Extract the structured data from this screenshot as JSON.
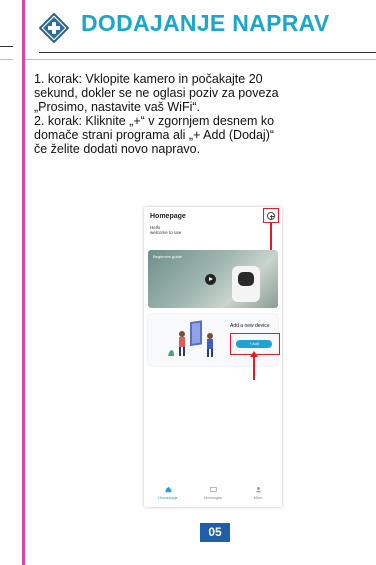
{
  "header": {
    "title": "DODAJANJE NAPRAV",
    "icon": "plus-diamond-icon",
    "accent_color": "#1aa7c9"
  },
  "instructions": {
    "lines": [
      "1. korak: Vklopite kamero in počakajte 20",
      "sekund, dokler se ne oglasi poziv za poveza",
      "„Prosimo, nastavite vaš WiFi“.",
      "2. korak: Kliknite „+“ v zgornjem desnem ko",
      "domače strani programa ali „+ Add (Dodaj)“",
      "če želite dodati novo napravo."
    ]
  },
  "phone": {
    "title": "Homepage",
    "hello": [
      "Hello",
      "welcome to use"
    ],
    "banner_label": "Beginners guide",
    "card_label": "Add a new device",
    "add_button": "+ Add",
    "nav": [
      {
        "label": "Homepage",
        "icon": "home-icon",
        "active": true
      },
      {
        "label": "Messages",
        "icon": "message-icon",
        "active": false
      },
      {
        "label": "Mine",
        "icon": "user-icon",
        "active": false
      }
    ]
  },
  "page_number": "05",
  "colors": {
    "highlight": "#e31c23",
    "border": "#e23fa7",
    "badge": "#1f5fa8"
  }
}
